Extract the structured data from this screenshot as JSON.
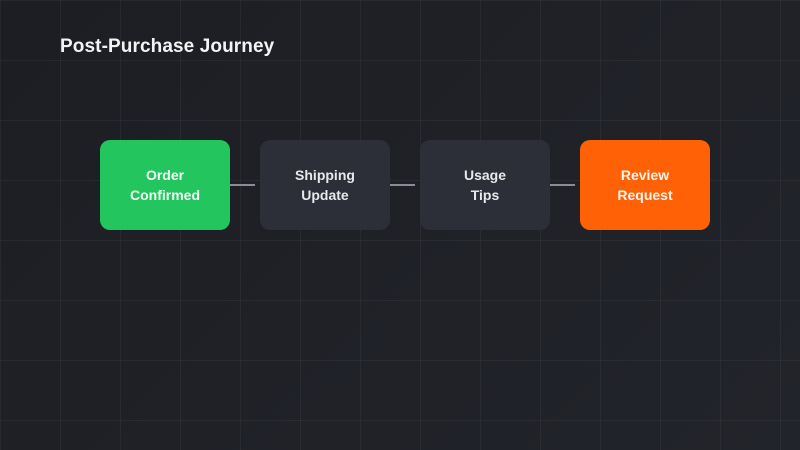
{
  "page": {
    "title": "Post-Purchase Journey"
  },
  "colors": {
    "background": "#1e2026",
    "grid": "#2a2d34",
    "node_default": "#2c2f38",
    "node_start": "#22c55e",
    "node_end": "#ff6106",
    "connector": "#8a8d96",
    "title_text": "#f2f3f5"
  },
  "diagram": {
    "type": "flow",
    "direction": "left-to-right",
    "nodes": [
      {
        "id": "order-confirmed",
        "label": "Order\nConfirmed",
        "color": "#22c55e",
        "text_color": "#f4fff7"
      },
      {
        "id": "shipping-update",
        "label": "Shipping\nUpdate",
        "color": "#2c2f38",
        "text_color": "#e8e9ec"
      },
      {
        "id": "usage-tips",
        "label": "Usage\nTips",
        "color": "#2c2f38",
        "text_color": "#e8e9ec"
      },
      {
        "id": "review-request",
        "label": "Review\nRequest",
        "color": "#ff6106",
        "text_color": "#fff5ee"
      }
    ],
    "edges": [
      {
        "from": "order-confirmed",
        "to": "shipping-update"
      },
      {
        "from": "shipping-update",
        "to": "usage-tips"
      },
      {
        "from": "usage-tips",
        "to": "review-request"
      }
    ]
  }
}
